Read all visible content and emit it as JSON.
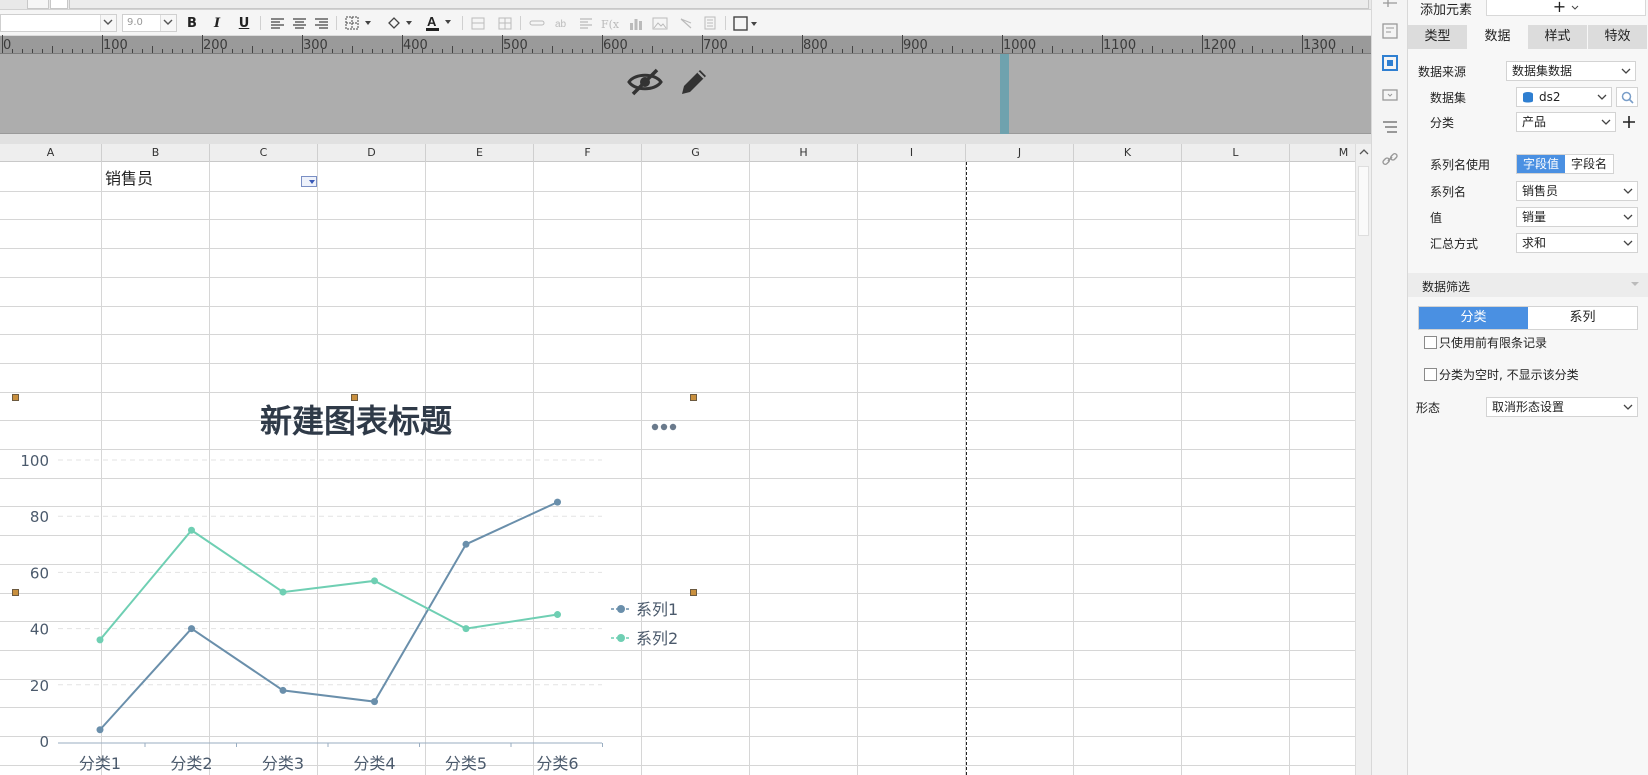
{
  "toolbar": {
    "font_name": "",
    "font_size": "9.0",
    "bold": "B",
    "italic": "I",
    "underline": "U"
  },
  "ruler": {
    "labels": [
      "0",
      "100",
      "200",
      "300",
      "400",
      "500",
      "600",
      "700",
      "800",
      "900",
      "1000",
      "1100",
      "1200",
      "1300"
    ]
  },
  "grid": {
    "columns": [
      "A",
      "B",
      "C",
      "D",
      "E",
      "F",
      "G",
      "H",
      "I",
      "J",
      "K",
      "L",
      "M"
    ],
    "cell_b1": "销售员"
  },
  "chart_data": {
    "type": "line",
    "title": "新建图表标题",
    "categories": [
      "分类1",
      "分类2",
      "分类3",
      "分类4",
      "分类5",
      "分类6"
    ],
    "series": [
      {
        "name": "系列1",
        "values": [
          4,
          40,
          18,
          14,
          70,
          85
        ],
        "color": "#6a8fab"
      },
      {
        "name": "系列2",
        "values": [
          36,
          75,
          53,
          57,
          40,
          45
        ],
        "color": "#6fcfb3"
      }
    ],
    "ylim": [
      0,
      100
    ],
    "yticks": [
      "0",
      "20",
      "40",
      "60",
      "80",
      "100"
    ],
    "grid": true,
    "legend_position": "right",
    "xlabel": "",
    "ylabel": "",
    "more_icon": "ellipsis-icon"
  },
  "panel": {
    "add_element_label": "添加元素",
    "add_button": "+",
    "tabs": [
      "类型",
      "数据",
      "样式",
      "特效"
    ],
    "active_tab": "数据",
    "data_source_label": "数据来源",
    "data_source_value": "数据集数据",
    "dataset_label": "数据集",
    "dataset_value": "ds2",
    "category_label": "分类",
    "category_value": "产品",
    "series_name_use_label": "系列名使用",
    "series_name_use_options": [
      "字段值",
      "字段名"
    ],
    "series_name_label": "系列名",
    "series_name_value": "销售员",
    "value_label": "值",
    "value_value": "销量",
    "summary_label": "汇总方式",
    "summary_value": "求和",
    "filter_header": "数据筛选",
    "filter_tabs": [
      "分类",
      "系列"
    ],
    "checkbox1": "只使用前有限条记录",
    "checkbox2": "分类为空时, 不显示该分类",
    "form_label": "形态",
    "form_value": "取消形态设置"
  },
  "colors": {
    "accent": "#4a90e2",
    "series1": "#6a8fab",
    "series2": "#6fcfb3",
    "band": "#adadad",
    "band_marker": "#6fa2ae"
  }
}
